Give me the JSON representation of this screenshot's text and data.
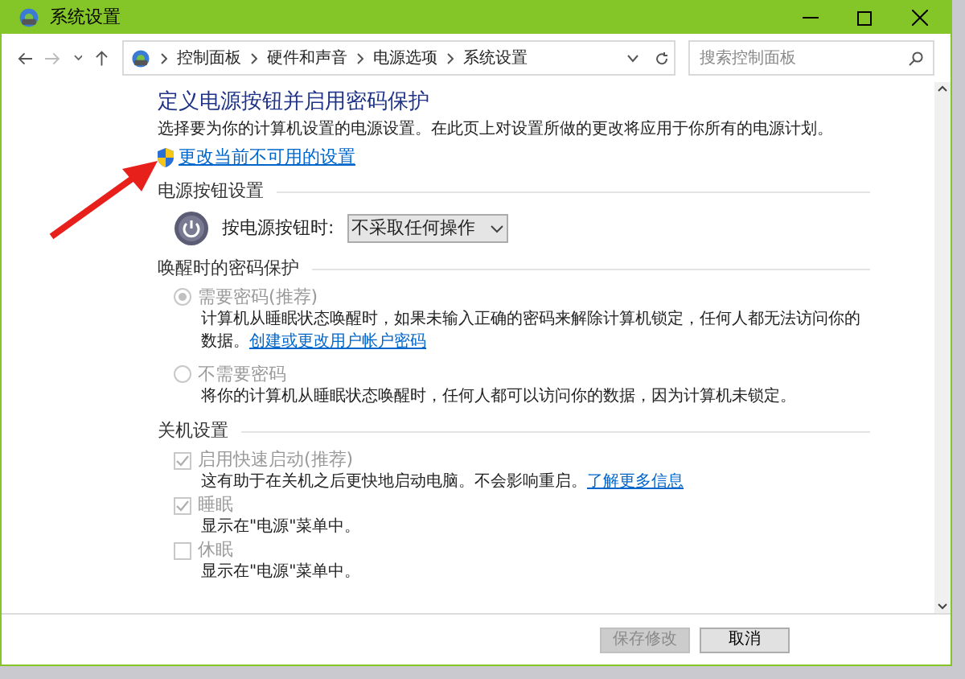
{
  "window": {
    "title": "系统设置"
  },
  "address": {
    "breadcrumb": [
      "控制面板",
      "硬件和声音",
      "电源选项",
      "系统设置"
    ],
    "search_placeholder": "搜索控制面板"
  },
  "page": {
    "heading": "定义电源按钮并启用密码保护",
    "description": "选择要为你的计算机设置的电源设置。在此页上对设置所做的更改将应用于你所有的电源计划。",
    "admin_link": "更改当前不可用的设置"
  },
  "sections": [
    {
      "kind": "power",
      "title": "电源按钮设置",
      "label": "按电源按钮时:",
      "value": "不采取任何操作"
    },
    {
      "kind": "radios",
      "title": "唤醒时的密码保护",
      "options": [
        {
          "label": "需要密码(推荐)",
          "selected": true,
          "disabled": true,
          "description": "计算机从睡眠状态唤醒时，如果未输入正确的密码来解除计算机锁定，任何人都无法访问你的数据。",
          "link": "创建或更改用户帐户密码"
        },
        {
          "label": "不需要密码",
          "selected": false,
          "disabled": true,
          "description": "将你的计算机从睡眠状态唤醒时，任何人都可以访问你的数据，因为计算机未锁定。"
        }
      ]
    },
    {
      "kind": "checkboxes",
      "title": "关机设置",
      "options": [
        {
          "label": "启用快速启动(推荐)",
          "checked": true,
          "disabled": true,
          "description": "这有助于在关机之后更快地启动电脑。不会影响重启。",
          "link": "了解更多信息"
        },
        {
          "label": "睡眠",
          "checked": true,
          "disabled": true,
          "description": "显示在\"电源\"菜单中。"
        },
        {
          "label": "休眠",
          "checked": false,
          "disabled": true,
          "description": "显示在\"电源\"菜单中。"
        }
      ]
    }
  ],
  "buttons": [
    {
      "label": "保存修改",
      "disabled": true
    },
    {
      "label": "取消",
      "disabled": false
    }
  ]
}
